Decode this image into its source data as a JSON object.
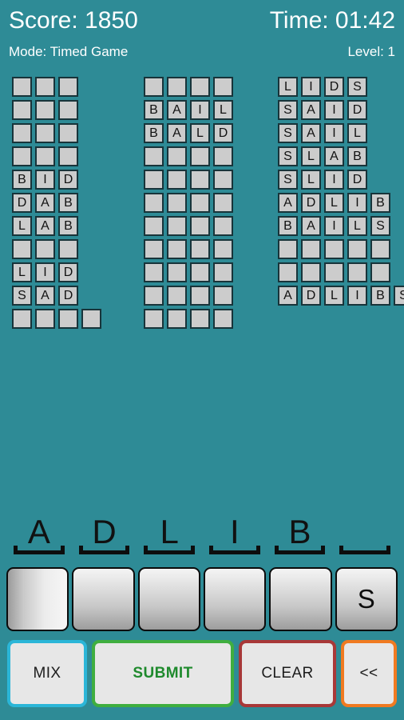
{
  "colors": {
    "background": "#2e8b96",
    "tile": "#cccccc",
    "tile_border": "#18343a",
    "header_text": "#ffffff",
    "mix_border": "#2bb6d8",
    "submit_border": "#3fae3f",
    "submit_text": "#1f8a2d",
    "clear_border": "#a83838",
    "back_border": "#f07a21"
  },
  "header": {
    "score": "Score: 1850",
    "time": "Time: 01:42",
    "mode": "Mode: Timed Game",
    "level": "Level: 1"
  },
  "board": {
    "grids": [
      {
        "name": "three-letter-words",
        "columns": 3,
        "rows": [
          [
            "",
            "",
            ""
          ],
          [
            "",
            "",
            ""
          ],
          [
            "",
            "",
            ""
          ],
          [
            "",
            "",
            ""
          ],
          [
            "B",
            "I",
            "D"
          ],
          [
            "D",
            "A",
            "B"
          ],
          [
            "L",
            "A",
            "B"
          ],
          [
            "",
            "",
            ""
          ],
          [
            "L",
            "I",
            "D"
          ],
          [
            "S",
            "A",
            "D"
          ],
          [
            "",
            "",
            "",
            ""
          ]
        ]
      },
      {
        "name": "four-letter-words",
        "columns": 4,
        "rows": [
          [
            "",
            "",
            "",
            ""
          ],
          [
            "B",
            "A",
            "I",
            "L"
          ],
          [
            "B",
            "A",
            "L",
            "D"
          ],
          [
            "",
            "",
            "",
            ""
          ],
          [
            "",
            "",
            "",
            ""
          ],
          [
            "",
            "",
            "",
            ""
          ],
          [
            "",
            "",
            "",
            ""
          ],
          [
            "",
            "",
            "",
            ""
          ],
          [
            "",
            "",
            "",
            ""
          ],
          [
            "",
            "",
            "",
            ""
          ],
          [
            "",
            "",
            "",
            ""
          ]
        ]
      },
      {
        "name": "long-words",
        "columns": 4,
        "rows": [
          [
            "L",
            "I",
            "D",
            "S"
          ],
          [
            "S",
            "A",
            "I",
            "D"
          ],
          [
            "S",
            "A",
            "I",
            "L"
          ],
          [
            "S",
            "L",
            "A",
            "B"
          ],
          [
            "S",
            "L",
            "I",
            "D"
          ],
          [
            "A",
            "D",
            "L",
            "I",
            "B"
          ],
          [
            "B",
            "A",
            "I",
            "L",
            "S"
          ],
          [
            "",
            "",
            "",
            "",
            ""
          ],
          [
            "",
            "",
            "",
            "",
            ""
          ],
          [
            "A",
            "D",
            "L",
            "I",
            "B",
            "S"
          ]
        ]
      }
    ]
  },
  "word_slots": {
    "letters": [
      "A",
      "D",
      "L",
      "I",
      "B",
      ""
    ]
  },
  "rack": {
    "keys": [
      {
        "label": "",
        "selected": true
      },
      {
        "label": "",
        "selected": false
      },
      {
        "label": "",
        "selected": false
      },
      {
        "label": "",
        "selected": false
      },
      {
        "label": "",
        "selected": false
      },
      {
        "label": "S",
        "selected": false
      }
    ]
  },
  "actions": {
    "mix": "MIX",
    "submit": "SUBMIT",
    "clear": "CLEAR",
    "back": "<<"
  }
}
